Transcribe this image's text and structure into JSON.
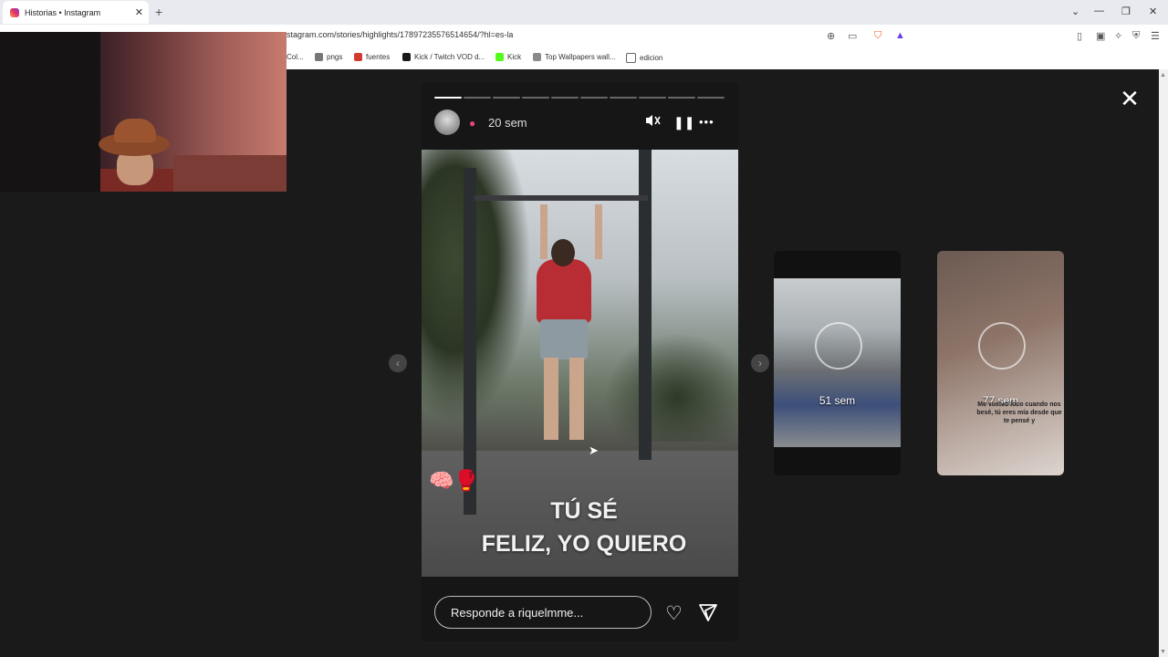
{
  "tab": {
    "title": "Historias • Instagram",
    "close": "✕",
    "new": "+"
  },
  "window_controls": [
    "⌄",
    "—",
    "❐",
    "✕"
  ],
  "address": {
    "url": "stagram.com/stories/highlights/17897235576514654/?hl=es-la"
  },
  "bookmarks": [
    {
      "label": "Col...",
      "color": "#888888"
    },
    {
      "label": "pngs",
      "color": "#777777"
    },
    {
      "label": "fuentes",
      "color": "#d03a2f"
    },
    {
      "label": "Kick / Twitch VOD d...",
      "color": "#1a1a1a"
    },
    {
      "label": "Kick",
      "color": "#53fc18"
    },
    {
      "label": "Top Wallpapers wall...",
      "color": "#8a8a8a"
    },
    {
      "label": "edicion",
      "color": "#666666"
    }
  ],
  "story": {
    "time_ago": "20 sem",
    "progress_done": 1,
    "progress_total": 10,
    "caption_line1": "TÚ SÉ",
    "caption_line2": "FELIZ, YO QUIERO",
    "reply_placeholder": "Responde a riquelmme...",
    "emojis": "🧠🥊"
  },
  "previews": [
    {
      "label": "51 sem"
    },
    {
      "label": "77 sem",
      "note": "Me vuelvo loco cuando nos besé, tú eres mía desde que te pensé y"
    }
  ],
  "icons": {
    "close_story": "✕",
    "mute": "🔇",
    "pause": "❚❚",
    "more": "•••",
    "heart": "♡",
    "send": "▽",
    "prev": "‹",
    "next": "›"
  }
}
